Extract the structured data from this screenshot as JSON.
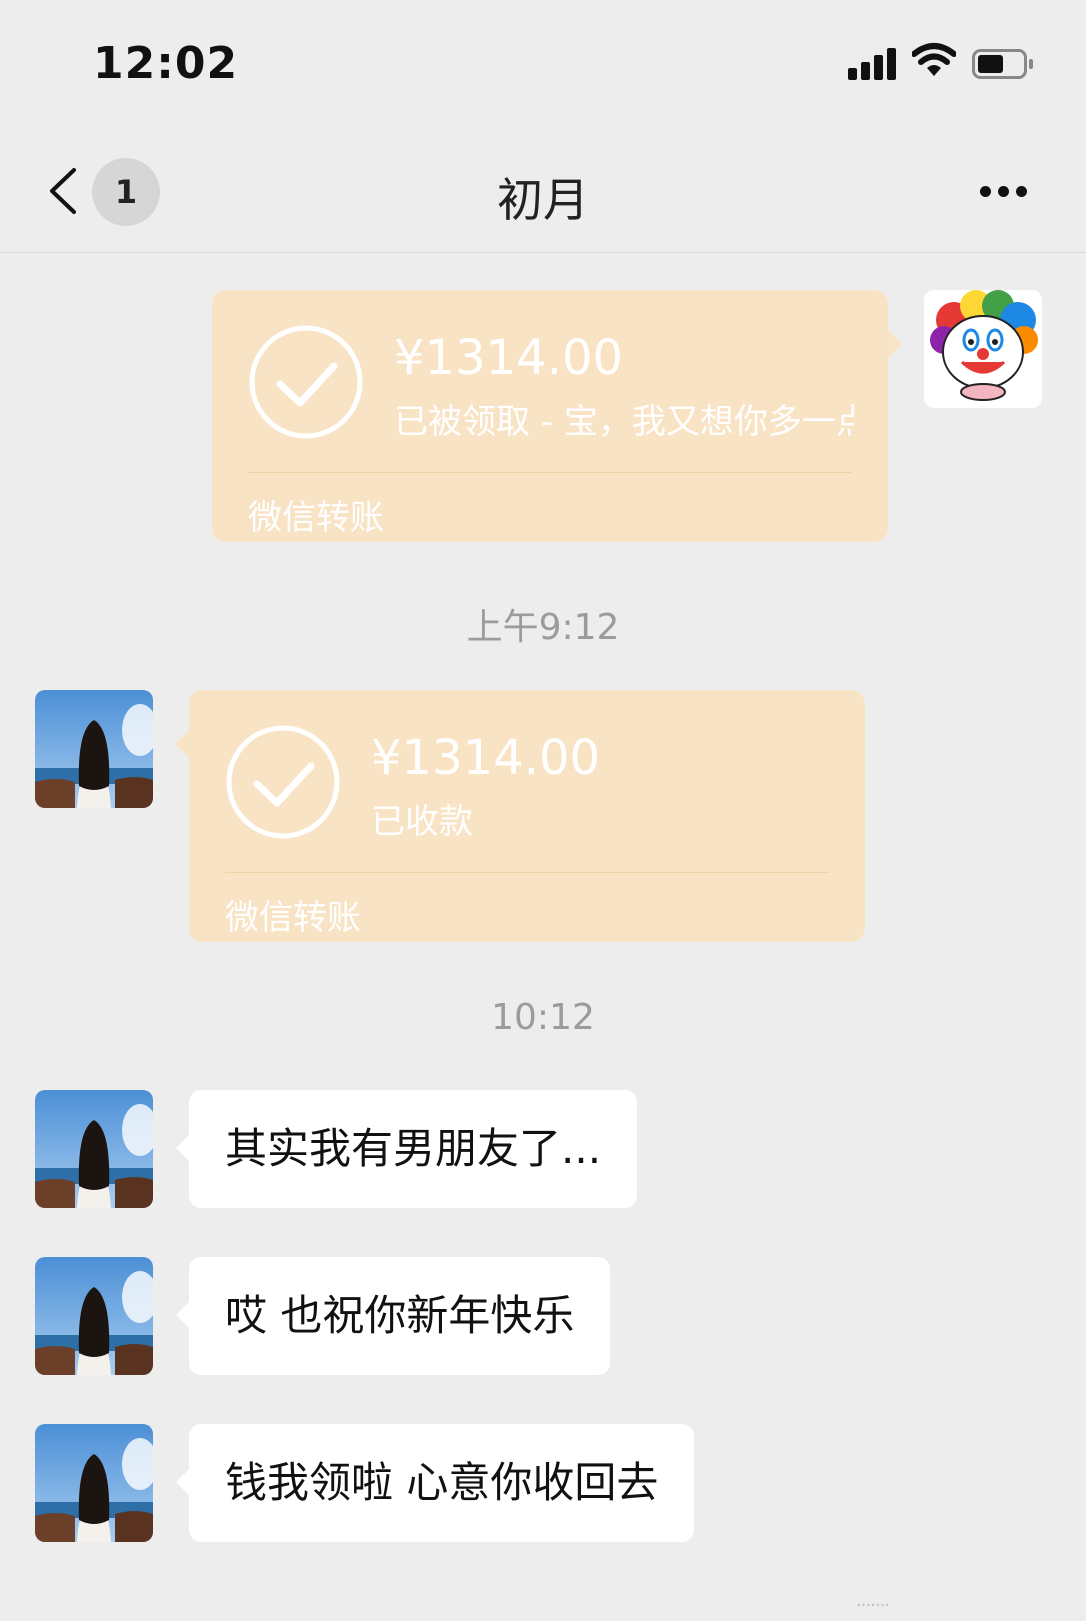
{
  "status_bar": {
    "time": "12:02"
  },
  "nav": {
    "unread_count": "1",
    "title": "初月"
  },
  "messages": {
    "transfer_sent": {
      "amount": "¥1314.00",
      "status": "已被领取 - 宝，我又想你多一点",
      "footer": "微信转账"
    },
    "time_1": "上午9:12",
    "transfer_received": {
      "amount": "¥1314.00",
      "status": "已收款",
      "footer": "微信转账"
    },
    "time_2": "10:12",
    "text_1": "其实我有男朋友了...",
    "text_2": "哎 也祝你新年快乐",
    "text_3": "钱我领啦 心意你收回去"
  },
  "colors": {
    "background": "#ededed",
    "transfer_card": "#f9e3c5",
    "bubble": "#ffffff"
  },
  "icons": [
    "back-icon",
    "more-icon",
    "check-circle-icon",
    "signal-icon",
    "wifi-icon",
    "battery-icon"
  ],
  "watermark": "·······"
}
